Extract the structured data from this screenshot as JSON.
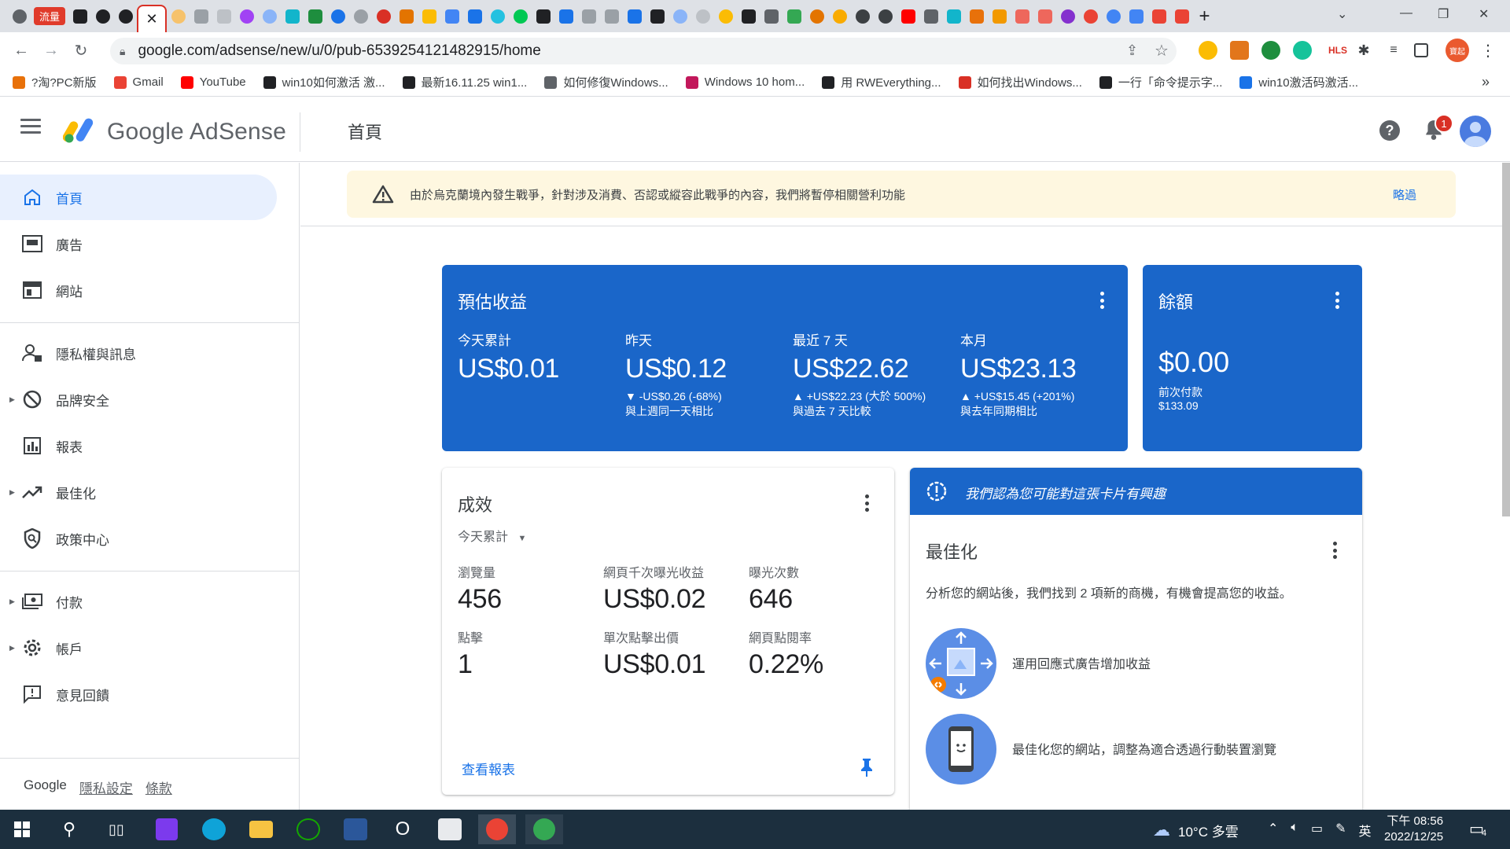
{
  "browser": {
    "tab_badge": "流量",
    "active_tab_close": "✕",
    "new_tab": "+",
    "url": "google.com/adsense/new/u/0/pub-6539254121482915/home",
    "profile_label": "寶起",
    "ext_hls": "HLS",
    "bookmarks": [
      {
        "label": "?淘?PC新版",
        "color": "#e8710a"
      },
      {
        "label": "Gmail",
        "color": "#ea4335"
      },
      {
        "label": "YouTube",
        "color": "#ff0000"
      },
      {
        "label": "win10如何激活 激...",
        "color": "#202124"
      },
      {
        "label": "最新16.11.25 win1...",
        "color": "#202124"
      },
      {
        "label": "如何修復Windows...",
        "color": "#5f6368"
      },
      {
        "label": "Windows 10 hom...",
        "color": "#c2185b"
      },
      {
        "label": "用 RWEverything...",
        "color": "#202124"
      },
      {
        "label": "如何找出Windows...",
        "color": "#d93025"
      },
      {
        "label": "一行「命令提示字...",
        "color": "#202124"
      },
      {
        "label": "win10激活码激活...",
        "color": "#1a73e8"
      }
    ],
    "more_bookmarks": "»"
  },
  "app": {
    "brand_google": "Google",
    "brand_adsense": "AdSense",
    "page_title": "首頁",
    "notification_count": "1",
    "help_symbol": "?"
  },
  "sidebar": {
    "items": [
      {
        "label": "首頁",
        "icon": "home-icon"
      },
      {
        "label": "廣告",
        "icon": "ads-icon"
      },
      {
        "label": "網站",
        "icon": "sites-icon"
      },
      {
        "label": "隱私權與訊息",
        "icon": "privacy-icon"
      },
      {
        "label": "品牌安全",
        "icon": "block-icon"
      },
      {
        "label": "報表",
        "icon": "reports-icon"
      },
      {
        "label": "最佳化",
        "icon": "trend-icon"
      },
      {
        "label": "政策中心",
        "icon": "policy-icon"
      },
      {
        "label": "付款",
        "icon": "payments-icon"
      },
      {
        "label": "帳戶",
        "icon": "gear-icon"
      },
      {
        "label": "意見回饋",
        "icon": "feedback-icon"
      }
    ],
    "footer": {
      "google": "Google",
      "privacy": "隱私設定",
      "terms": "條款"
    }
  },
  "banner": {
    "text": "由於烏克蘭境內發生戰爭，針對涉及消費、否認或縱容此戰爭的內容，我們將暫停相關營利功能",
    "dismiss": "略過"
  },
  "earnings": {
    "title": "預估收益",
    "metrics": [
      {
        "label": "今天累計",
        "value": "US$0.01",
        "delta": "",
        "compare": ""
      },
      {
        "label": "昨天",
        "value": "US$0.12",
        "delta": "▼ -US$0.26 (-68%)",
        "compare": "與上週同一天相比"
      },
      {
        "label": "最近 7 天",
        "value": "US$22.62",
        "delta": "▲ +US$22.23 (大於 500%)",
        "compare": "與過去 7 天比較"
      },
      {
        "label": "本月",
        "value": "US$23.13",
        "delta": "▲ +US$15.45 (+201%)",
        "compare": "與去年同期相比"
      }
    ]
  },
  "balance": {
    "title": "餘額",
    "value": "$0.00",
    "last_payment_label": "前次付款",
    "last_payment_value": "$133.09"
  },
  "performance": {
    "title": "成效",
    "range": "今天累計",
    "metrics": [
      {
        "label": "瀏覽量",
        "value": "456"
      },
      {
        "label": "網頁千次曝光收益",
        "value": "US$0.02"
      },
      {
        "label": "曝光次數",
        "value": "646"
      },
      {
        "label": "點擊",
        "value": "1"
      },
      {
        "label": "單次點擊出價",
        "value": "US$0.01"
      },
      {
        "label": "網頁點閱率",
        "value": "0.22%"
      }
    ],
    "view_report": "查看報表"
  },
  "suggestion": {
    "header": "我們認為您可能對這張卡片有興趣",
    "title": "最佳化",
    "description": "分析您的網站後，我們找到 2 項新的商機，有機會提高您的收益。",
    "items": [
      {
        "text": "運用回應式廣告增加收益"
      },
      {
        "text": "最佳化您的網站，調整為適合透過行動裝置瀏覽"
      }
    ]
  },
  "taskbar": {
    "weather": "10°C 多雲",
    "ime": "英",
    "time": "下午 08:56",
    "date": "2022/12/25",
    "notif_count": "4"
  },
  "colors": {
    "card_blue": "#1a66c9",
    "link_blue": "#1a73e8",
    "banner_bg": "#fef7e0"
  }
}
